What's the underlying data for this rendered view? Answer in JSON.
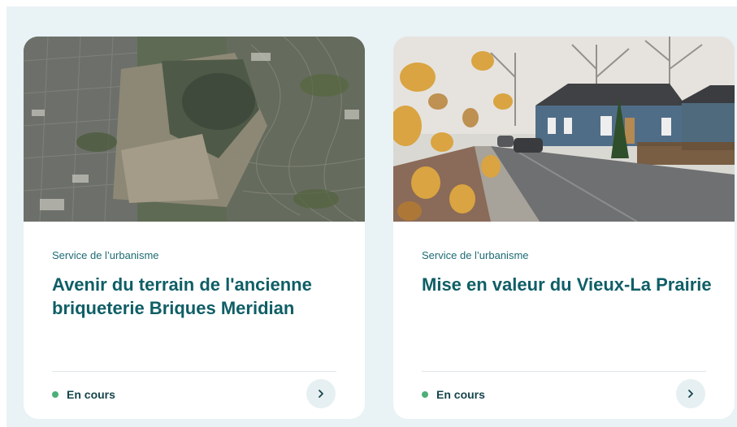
{
  "cards": [
    {
      "service": "Service de l’urbanisme",
      "title": "Avenir du terrain de l'ancienne briqueterie Briques Meridian",
      "status": "En cours",
      "image": "aerial-satellite-view",
      "arrow_icon": "chevron-right-icon"
    },
    {
      "service": "Service de l’urbanisme",
      "title": "Mise en valeur du Vieux-La Prairie",
      "status": "En cours",
      "image": "historic-street-photo",
      "arrow_icon": "chevron-right-icon"
    }
  ],
  "colors": {
    "panel_bg": "#e9f2f5",
    "title": "#0f5e66",
    "service": "#1d6b73",
    "status_dot": "#4caf77",
    "arrow_button_bg": "#e6f0f2"
  }
}
